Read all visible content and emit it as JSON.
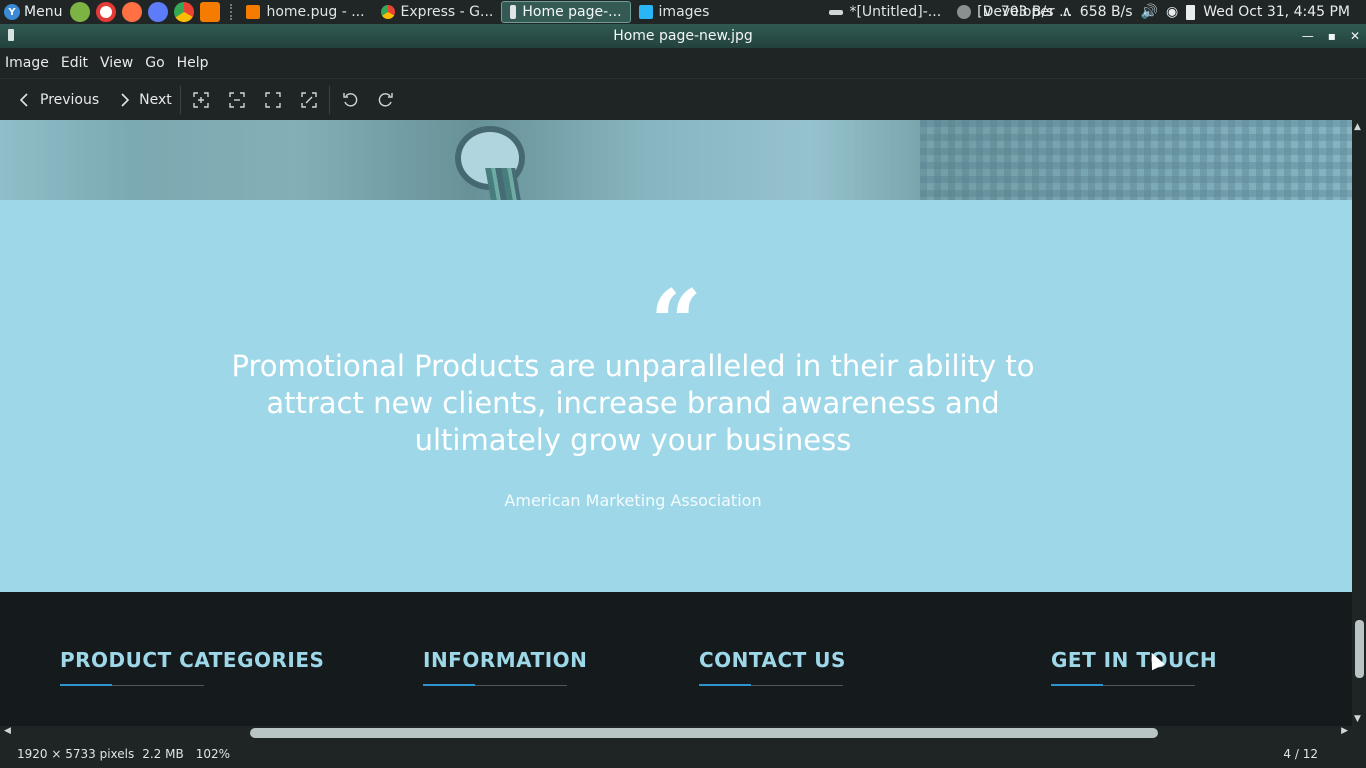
{
  "taskbar": {
    "menu_label": "Menu",
    "tasks": [
      {
        "label": "home.pug - ...",
        "active": false
      },
      {
        "label": "Express - G...",
        "active": false
      },
      {
        "label": "Home page-...",
        "active": true
      },
      {
        "label": "images",
        "active": false
      },
      {
        "label": "*[Untitled]-...",
        "active": false
      },
      {
        "label": "[Developer ...",
        "active": false
      }
    ],
    "net_down": "703 B/s",
    "net_up": "658 B/s",
    "clock": "Wed Oct 31,  4:45 PM"
  },
  "window": {
    "title": "Home page-new.jpg"
  },
  "menubar": {
    "items": [
      "Image",
      "Edit",
      "View",
      "Go",
      "Help"
    ]
  },
  "toolbar": {
    "previous_label": "Previous",
    "next_label": "Next"
  },
  "content": {
    "quote_mark": "“",
    "quote": "Promotional Products are unparalleled in their ability to attract new clients, increase brand awareness and ultimately grow your business",
    "author": "American Marketing Association",
    "footer_headings": [
      "PRODUCT CATEGORIES",
      "INFORMATION",
      "CONTACT US",
      "GET IN TOUCH"
    ]
  },
  "statusbar": {
    "dimensions": "1920 × 5733 pixels",
    "filesize": "2.2 MB",
    "zoom": "102%",
    "page": "4 / 12"
  },
  "colors": {
    "quote_band": "#9ed8e8",
    "footer_bg": "#151a1d",
    "footer_heading": "#9ed8e8",
    "footer_accent": "#2f93d0",
    "titlebar": "#315953"
  }
}
